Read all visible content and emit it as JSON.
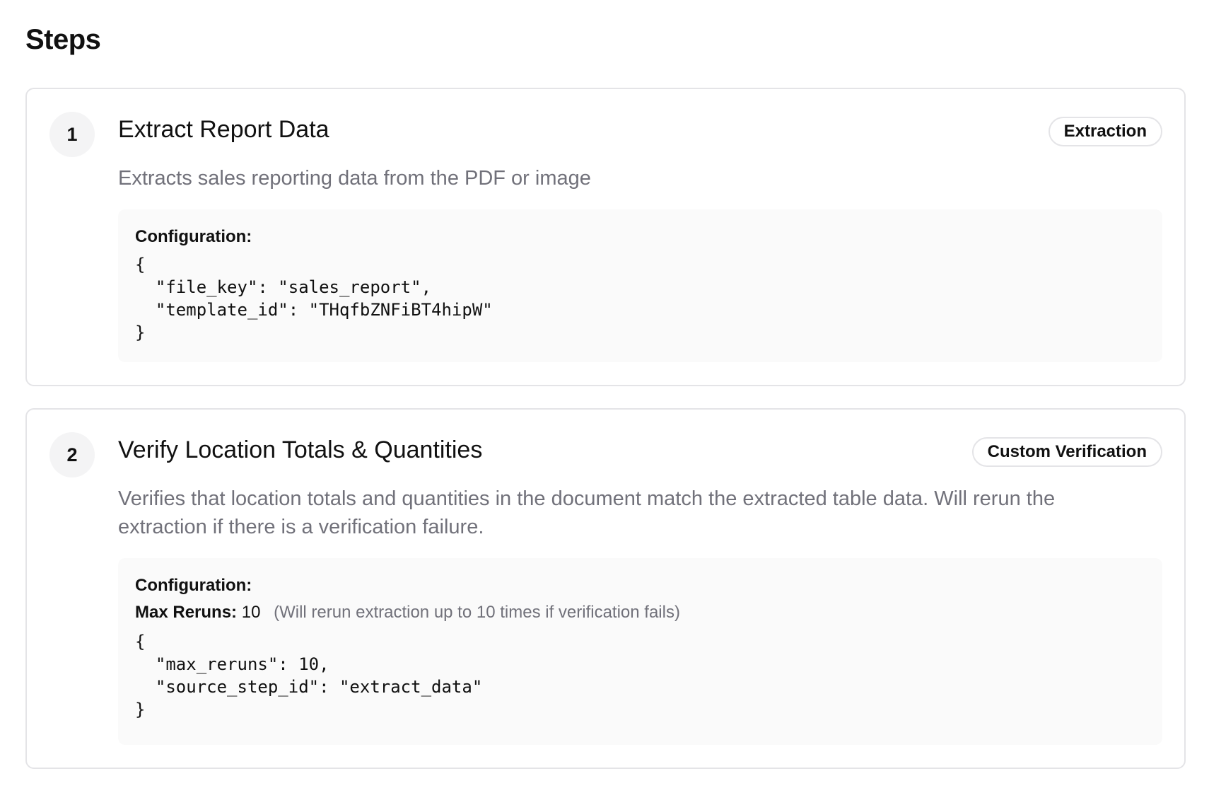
{
  "page": {
    "title": "Steps"
  },
  "steps": [
    {
      "number": "1",
      "title": "Extract Report Data",
      "badge": "Extraction",
      "description": "Extracts sales reporting data from the PDF or image",
      "config_label": "Configuration:",
      "code": "{\n  \"file_key\": \"sales_report\",\n  \"template_id\": \"THqfbZNFiBT4hipW\"\n}"
    },
    {
      "number": "2",
      "title": "Verify Location Totals & Quantities",
      "badge": "Custom Verification",
      "description": "Verifies that location totals and quantities in the document match the extracted table data. Will rerun the extraction if there is a verification failure.",
      "config_label": "Configuration:",
      "max_reruns_label": "Max Reruns:",
      "max_reruns_value": "10",
      "max_reruns_hint": "(Will rerun extraction up to 10 times if verification fails)",
      "code": "{\n  \"max_reruns\": 10,\n  \"source_step_id\": \"extract_data\"\n}"
    }
  ],
  "colors": {
    "text": "#111111",
    "muted_text": "#71717a",
    "border": "#e4e4e7",
    "badge_circle": "#f4f4f5",
    "config_bg": "#fafafa"
  }
}
